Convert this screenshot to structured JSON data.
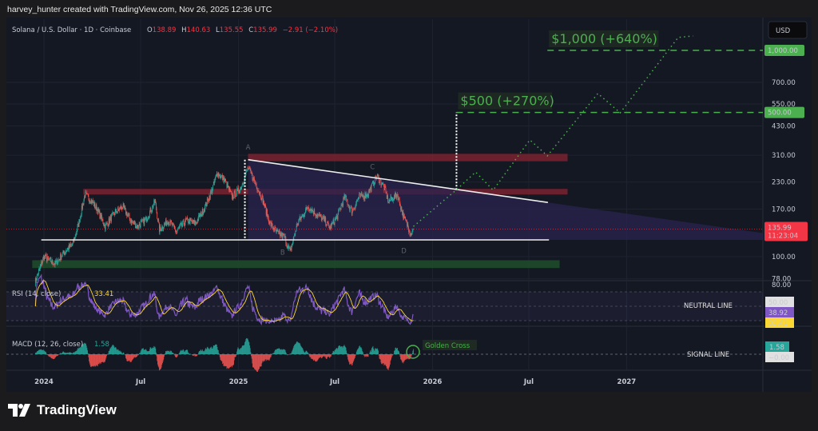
{
  "credit": "harvey_hunter created with TradingView.com, Nov 26, 2025 12:36 UTC",
  "header": {
    "symbol": "Solana / U.S. Dollar · 1D · Coinbase",
    "o_label": "O",
    "o": "138.89",
    "h_label": "H",
    "h": "140.63",
    "l_label": "L",
    "l": "135.55",
    "c_label": "C",
    "c": "135.99",
    "change": "−2.91 (−2.10%)"
  },
  "currency_button": "USD",
  "logo": "TradingView",
  "colors": {
    "up": "#26a69a",
    "down": "#ef5350",
    "target": "#4caf50",
    "rsi": "#7e57c2",
    "rsi_ma": "#fdd835",
    "price_badge": "#f23645",
    "zone_red": "#7a2230",
    "zone_green": "#1f4d2c",
    "pattern_fill": "#2a2350"
  },
  "chart_data": {
    "type": "candlestick",
    "scale": "log",
    "ylim": [
      78,
      1250
    ],
    "xlim": [
      "2023-12-09",
      "2027-07-15"
    ],
    "grid": true,
    "x_ticks": [
      {
        "date": "2024-01-01",
        "label": "2024"
      },
      {
        "date": "2024-07-01",
        "label": "Jul"
      },
      {
        "date": "2025-01-01",
        "label": "2025"
      },
      {
        "date": "2025-07-01",
        "label": "Jul"
      },
      {
        "date": "2026-01-01",
        "label": "2026"
      },
      {
        "date": "2026-07-01",
        "label": "Jul"
      },
      {
        "date": "2027-01-01",
        "label": "2027"
      }
    ],
    "y_ticks": [
      {
        "value": 1000,
        "label": "1,000.00",
        "highlight": true
      },
      {
        "value": 700,
        "label": "700.00"
      },
      {
        "value": 550,
        "label": "550.00"
      },
      {
        "value": 500,
        "label": "500.00",
        "highlight": true
      },
      {
        "value": 430,
        "label": "430.00"
      },
      {
        "value": 310,
        "label": "310.00"
      },
      {
        "value": 230,
        "label": "230.00"
      },
      {
        "value": 170,
        "label": "170.00"
      },
      {
        "value": 100,
        "label": "100.00"
      },
      {
        "value": 78,
        "label": "78.00"
      }
    ],
    "last_price": {
      "value": 135.99,
      "label": "135.99",
      "countdown": "11:23:04"
    },
    "closes": [
      [
        "2023-12-15",
        75
      ],
      [
        "2024-01-01",
        100
      ],
      [
        "2024-01-22",
        92
      ],
      [
        "2024-02-08",
        105
      ],
      [
        "2024-02-24",
        115
      ],
      [
        "2024-03-05",
        140
      ],
      [
        "2024-03-18",
        200
      ],
      [
        "2024-03-28",
        190
      ],
      [
        "2024-04-10",
        170
      ],
      [
        "2024-04-25",
        140
      ],
      [
        "2024-05-15",
        165
      ],
      [
        "2024-05-28",
        175
      ],
      [
        "2024-06-12",
        150
      ],
      [
        "2024-06-25",
        140
      ],
      [
        "2024-07-10",
        150
      ],
      [
        "2024-07-28",
        185
      ],
      [
        "2024-08-05",
        135
      ],
      [
        "2024-08-22",
        150
      ],
      [
        "2024-09-06",
        132
      ],
      [
        "2024-09-25",
        150
      ],
      [
        "2024-10-12",
        145
      ],
      [
        "2024-10-28",
        170
      ],
      [
        "2024-11-12",
        210
      ],
      [
        "2024-11-22",
        255
      ],
      [
        "2024-12-06",
        235
      ],
      [
        "2024-12-20",
        195
      ],
      [
        "2025-01-05",
        215
      ],
      [
        "2025-01-19",
        270
      ],
      [
        "2025-02-01",
        230
      ],
      [
        "2025-02-15",
        190
      ],
      [
        "2025-03-01",
        145
      ],
      [
        "2025-03-15",
        130
      ],
      [
        "2025-03-28",
        125
      ],
      [
        "2025-04-08",
        105
      ],
      [
        "2025-04-22",
        145
      ],
      [
        "2025-05-12",
        175
      ],
      [
        "2025-05-28",
        160
      ],
      [
        "2025-06-12",
        150
      ],
      [
        "2025-06-22",
        138
      ],
      [
        "2025-07-05",
        155
      ],
      [
        "2025-07-20",
        195
      ],
      [
        "2025-08-02",
        165
      ],
      [
        "2025-08-16",
        195
      ],
      [
        "2025-09-01",
        200
      ],
      [
        "2025-09-18",
        245
      ],
      [
        "2025-10-01",
        220
      ],
      [
        "2025-10-10",
        185
      ],
      [
        "2025-10-27",
        200
      ],
      [
        "2025-11-06",
        160
      ],
      [
        "2025-11-21",
        130
      ],
      [
        "2025-11-26",
        135.99
      ]
    ],
    "zones": [
      {
        "kind": "resistance",
        "from": "2024-03-15",
        "to": "2026-09-12",
        "low": 200,
        "high": 213
      },
      {
        "kind": "resistance",
        "from": "2025-01-19",
        "to": "2026-09-12",
        "low": 290,
        "high": 315
      },
      {
        "kind": "support",
        "from": "2023-12-10",
        "to": "2026-08-28",
        "low": 88,
        "high": 96
      }
    ],
    "pattern": {
      "upper_line": [
        [
          "2025-01-19",
          295
        ],
        [
          "2026-08-06",
          183
        ]
      ],
      "lower_line": [
        [
          "2023-12-27",
          120.5
        ],
        [
          "2026-08-08",
          120.5
        ]
      ],
      "points": [
        {
          "label": "A",
          "date": "2025-01-19",
          "price": 330
        },
        {
          "label": "B",
          "date": "2025-03-25",
          "price": 102
        },
        {
          "label": "C",
          "date": "2025-09-10",
          "price": 265
        },
        {
          "label": "D",
          "date": "2025-11-08",
          "price": 104
        }
      ]
    },
    "targets": [
      {
        "value": 500,
        "label": "$500 (+270%)",
        "from": "2026-02-15"
      },
      {
        "value": 1000,
        "label": "$1,000 (+640%)",
        "from": "2026-08-05"
      }
    ],
    "breakout_marker": {
      "date": "2026-02-15",
      "from": 211,
      "to": 500
    },
    "projection": [
      [
        "2025-11-26",
        140
      ],
      [
        "2026-02-15",
        211
      ],
      [
        "2026-03-23",
        257
      ],
      [
        "2026-04-25",
        210
      ],
      [
        "2026-07-03",
        368
      ],
      [
        "2026-08-05",
        308
      ],
      [
        "2026-11-08",
        618
      ],
      [
        "2026-12-20",
        498
      ],
      [
        "2027-04-08",
        1155
      ],
      [
        "2027-05-06",
        1175
      ]
    ],
    "rsi": {
      "label": "RSI (14, close)",
      "value": "38.92",
      "ma_value": "33.41",
      "level": "50.00",
      "top_label": "80.00",
      "neutral_label": "NEUTRAL LINE"
    },
    "macd": {
      "label": "MACD (12, 26, close)",
      "value": "1.58",
      "signal_value": "−0.00",
      "signal_label": "SIGNAL LINE",
      "annotation": "Golden Cross"
    }
  }
}
